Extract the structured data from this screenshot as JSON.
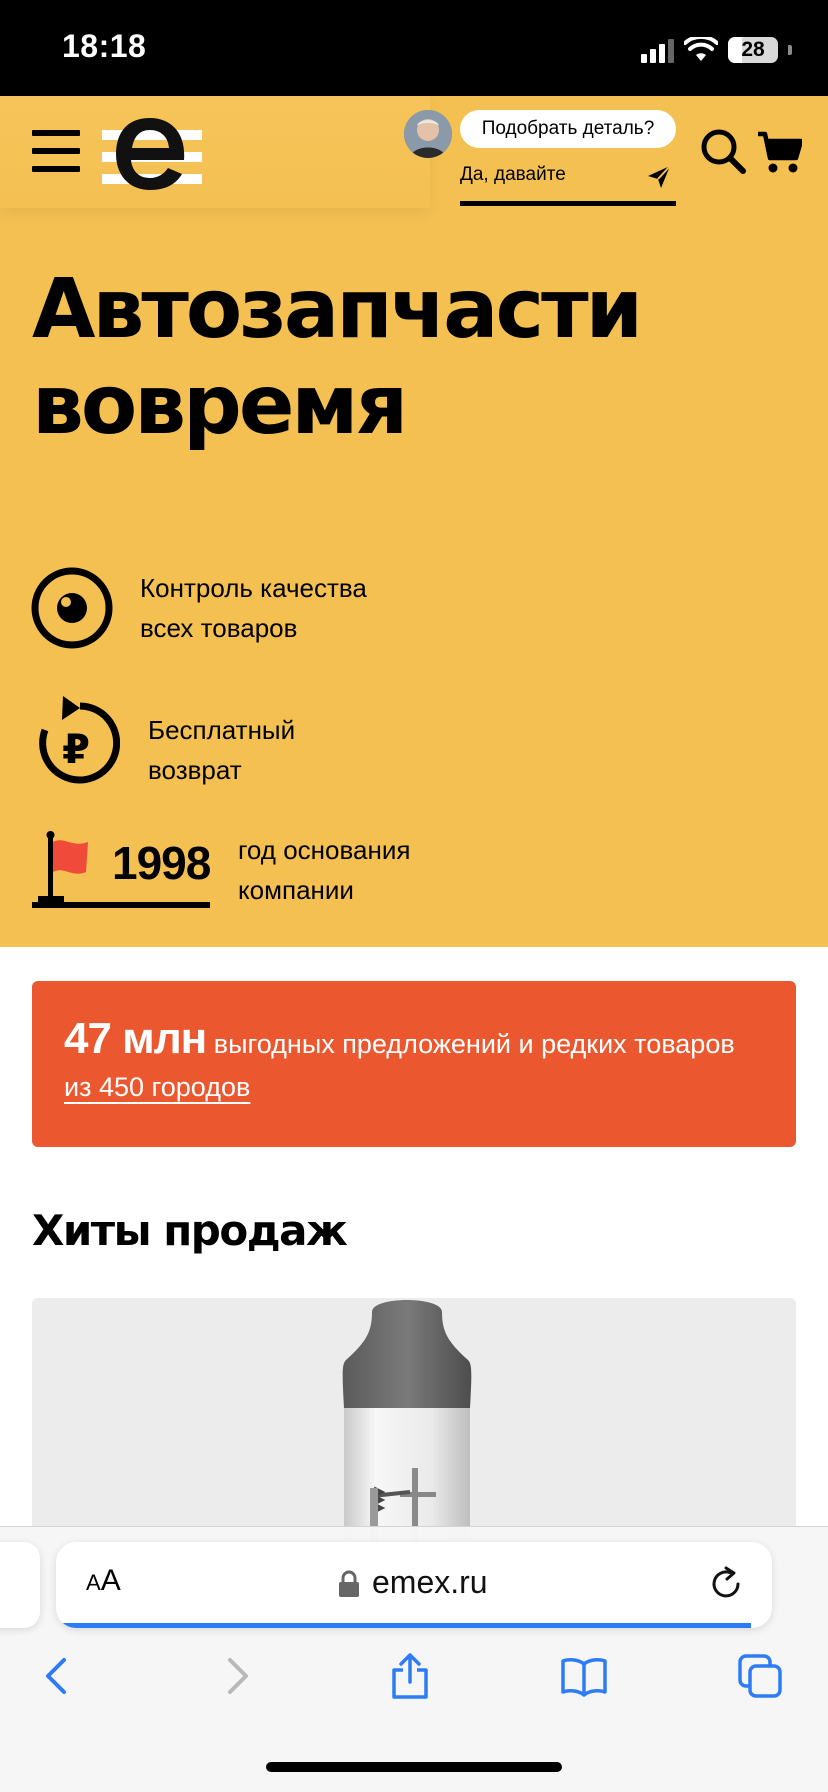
{
  "status_bar": {
    "time": "18:18",
    "battery": "28",
    "battery_level": 0.28,
    "icons": [
      "cellular-signal-icon",
      "wifi-icon",
      "battery-icon"
    ]
  },
  "colors": {
    "hero_background": "#f4c052",
    "promo_background": "#eb582f",
    "flag": "#ef4a3a",
    "accent_blue": "#2d7cf6"
  },
  "header": {
    "icons": [
      "menu-icon",
      "logo-icon",
      "search-icon",
      "cart-icon"
    ],
    "assistant": {
      "question": "Подобрать деталь?",
      "reply": "Да, давайте"
    }
  },
  "hero": {
    "title_line1": "Автозапчасти",
    "title_line2": "вовремя",
    "features": [
      {
        "icon": "eye-icon",
        "line1": "Контроль качества",
        "line2": "всех товаров"
      },
      {
        "icon": "ruble-return-icon",
        "line1": "Бесплатный",
        "line2": "возврат"
      },
      {
        "icon": "flag-icon",
        "value": "1998",
        "line1": "год основания",
        "line2": "компании"
      }
    ]
  },
  "promo": {
    "count": "47 млн",
    "text_part1": " выгодных предложений и редких товаров ",
    "link": "из 450 городов"
  },
  "bestsellers": {
    "title": "Хиты продаж",
    "product_image_icon": "headlight-bulb-icon"
  },
  "browser": {
    "text_size_small": "A",
    "text_size_large": "A",
    "url": "emex.ru",
    "load_progress": 0.97,
    "nav_icons": [
      "back-icon",
      "forward-icon",
      "share-icon",
      "bookmarks-icon",
      "tabs-icon"
    ]
  }
}
